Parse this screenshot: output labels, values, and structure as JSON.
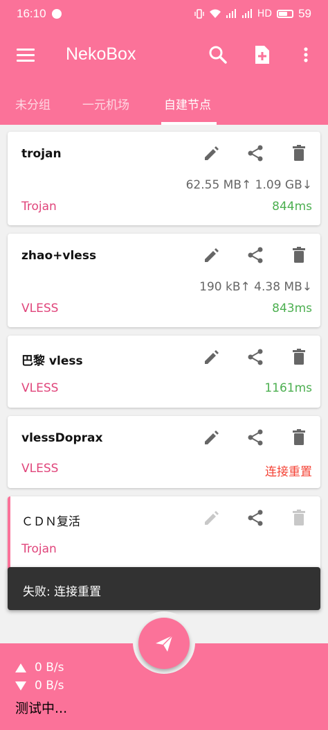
{
  "status_bar": {
    "time": "16:10",
    "network": "HD",
    "battery": "59"
  },
  "app_bar": {
    "title": "NekoBox",
    "menu_icon": "menu-icon",
    "search_icon": "search-icon",
    "add_icon": "add-file-icon",
    "more_icon": "more-vert-icon"
  },
  "tabs": [
    {
      "label": "未分组",
      "active": false
    },
    {
      "label": "一元机场",
      "active": false
    },
    {
      "label": "自建节点",
      "active": true
    }
  ],
  "profiles": [
    {
      "name": "trojan",
      "type": "Trojan",
      "traffic": "62.55 MB↑ 1.09 GB↓",
      "latency": "844ms",
      "latency_status": "ok"
    },
    {
      "name": "zhao+vless",
      "type": "VLESS",
      "traffic": "190 kB↑ 4.38 MB↓",
      "latency": "843ms",
      "latency_status": "ok"
    },
    {
      "name": "巴黎 vless",
      "type": "VLESS",
      "traffic": "",
      "latency": "1161ms",
      "latency_status": "ok"
    },
    {
      "name": "vlessDoprax",
      "type": "VLESS",
      "traffic": "",
      "latency": "连接重置",
      "latency_status": "error"
    },
    {
      "name": "ＣＤＮ复活",
      "type": "Trojan",
      "traffic": "",
      "latency": "",
      "latency_status": "selected"
    }
  ],
  "snackbar": {
    "message": "失败: 连接重置"
  },
  "bottom": {
    "upload": "0 B/s",
    "download": "0 B/s",
    "status": "测试中..."
  },
  "colors": {
    "primary": "#fb7299",
    "type_text": "#e0457b",
    "latency_ok": "#4caf50",
    "latency_error": "#f44336"
  }
}
